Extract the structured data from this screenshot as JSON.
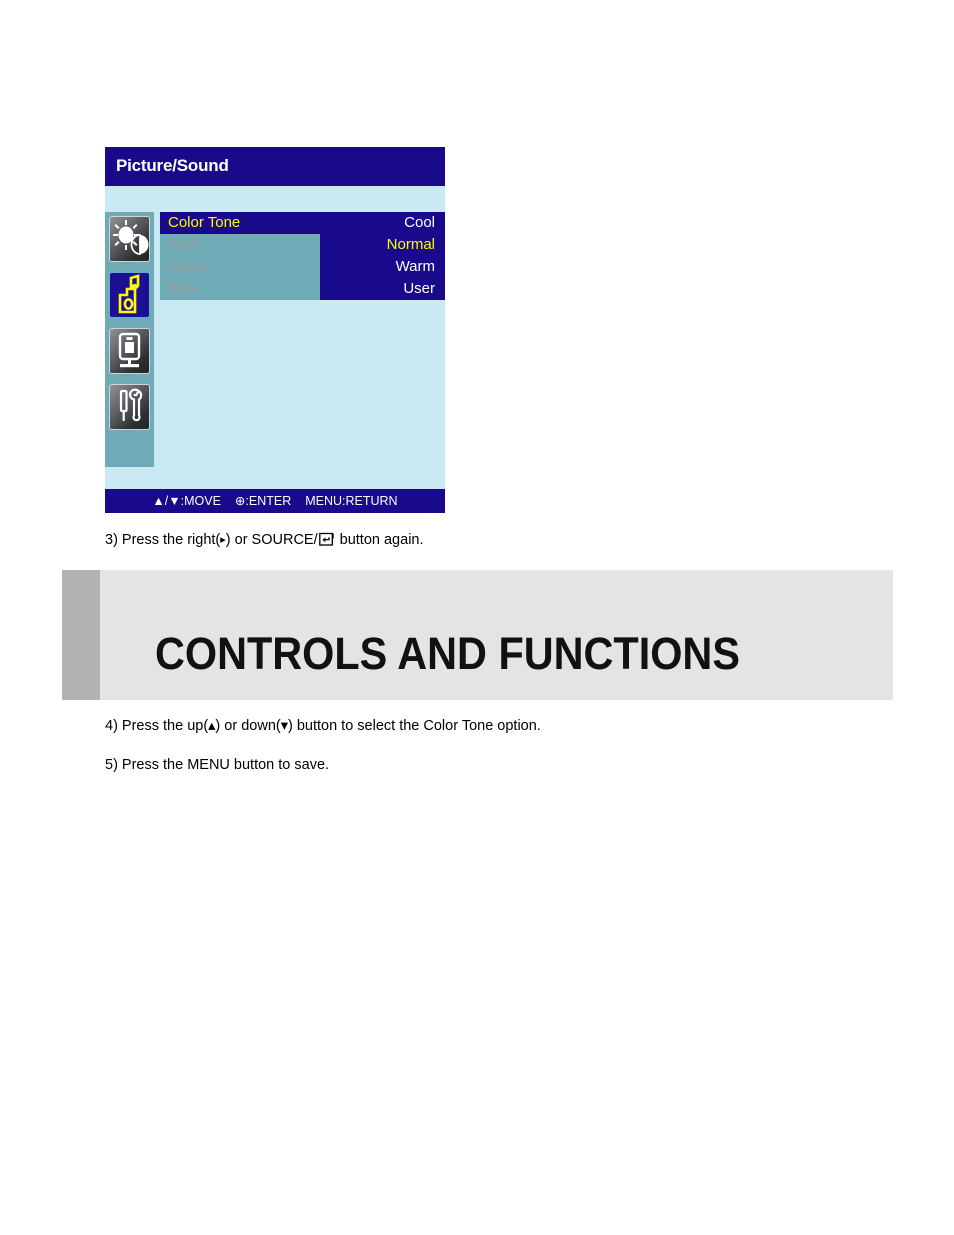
{
  "osd": {
    "title": "Picture/Sound",
    "icons": [
      {
        "name": "brightness-contrast-icon",
        "state": "inactive"
      },
      {
        "name": "sound-icon",
        "state": "active"
      },
      {
        "name": "display-monitor-icon",
        "state": "inactive"
      },
      {
        "name": "setup-tools-icon",
        "state": "inactive"
      }
    ],
    "menu_items": [
      {
        "label": "Color Tone",
        "state": "selected"
      },
      {
        "label": "Red",
        "state": "dimmed"
      },
      {
        "label": "Green",
        "state": "dimmed"
      },
      {
        "label": "Blue",
        "state": "dimmed"
      }
    ],
    "options": [
      {
        "label": "Cool",
        "state": "normal"
      },
      {
        "label": "Normal",
        "state": "current"
      },
      {
        "label": "Warm",
        "state": "normal"
      },
      {
        "label": "User",
        "state": "normal"
      }
    ],
    "hint_bar": {
      "move": "▲/▼:MOVE",
      "enter": "⊕:ENTER",
      "return": "MENU:RETURN"
    },
    "colors": {
      "title_bar": "#190a8c",
      "panel_bg": "#c9eaf2",
      "rail_bg": "#6fabb7",
      "highlight": "#fffc00",
      "dimmed_text": "#9a9a9a"
    }
  },
  "steps": {
    "step3_prefix": "3) Press the right(",
    "step3_arrow": "▸",
    "step3_middle": ") or SOURCE/",
    "step3_suffix": " button again.",
    "step4": "4) Press the up(▴) or down(▾) button to select the Color Tone option.",
    "step5": "5) Press the MENU button to save."
  },
  "banner": {
    "title": "CONTROLS AND FUNCTIONS",
    "accent_color": "#b2b2b2",
    "bg_color": "#e4e4e4"
  }
}
